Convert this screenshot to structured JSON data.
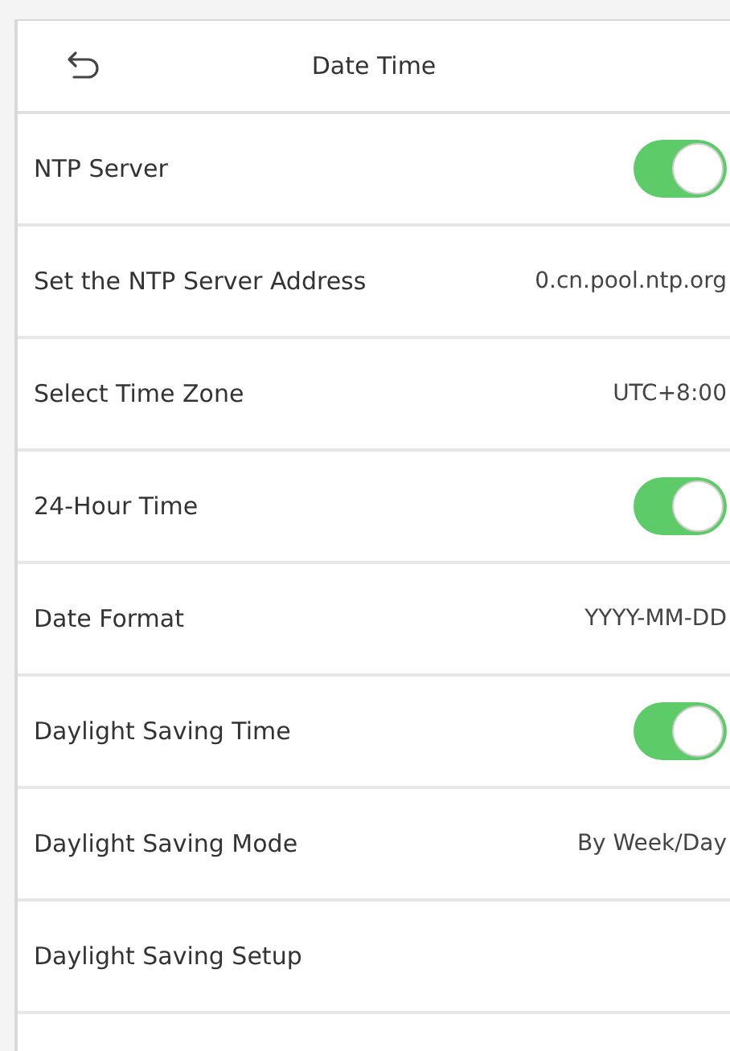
{
  "header": {
    "title": "Date Time"
  },
  "rows": [
    {
      "kind": "toggle",
      "label": "NTP Server",
      "on": true
    },
    {
      "kind": "value",
      "label": "Set the NTP Server Address",
      "value": "0.cn.pool.ntp.org"
    },
    {
      "kind": "value",
      "label": "Select Time Zone",
      "value": "UTC+8:00"
    },
    {
      "kind": "toggle",
      "label": "24-Hour Time",
      "on": true
    },
    {
      "kind": "value",
      "label": "Date Format",
      "value": "YYYY-MM-DD"
    },
    {
      "kind": "toggle",
      "label": "Daylight Saving Time",
      "on": true
    },
    {
      "kind": "value",
      "label": "Daylight Saving Mode",
      "value": "By Week/Day"
    },
    {
      "kind": "link",
      "label": "Daylight Saving Setup"
    }
  ]
}
